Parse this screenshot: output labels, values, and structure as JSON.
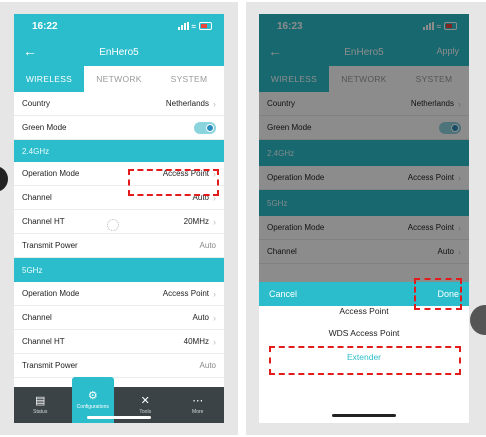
{
  "left": {
    "status": {
      "time": "16:22"
    },
    "navbar": {
      "title": "EnHero5"
    },
    "tabs": [
      "WIRELESS",
      "NETWORK",
      "SYSTEM"
    ],
    "rows_top": [
      {
        "label": "Country",
        "value": "Netherlands"
      },
      {
        "label": "Green Mode",
        "value": "",
        "toggle_on": true
      }
    ],
    "section_24": "2.4GHz",
    "rows_24": [
      {
        "label": "Operation Mode",
        "value": "Access Point"
      },
      {
        "label": "Channel",
        "value": "Auto"
      },
      {
        "label": "Channel HT",
        "value": "20MHz"
      },
      {
        "label": "Transmit Power",
        "value": "Auto"
      }
    ],
    "section_5": "5GHz",
    "rows_5": [
      {
        "label": "Operation Mode",
        "value": "Access Point"
      },
      {
        "label": "Channel",
        "value": "Auto"
      },
      {
        "label": "Channel HT",
        "value": "40MHz"
      },
      {
        "label": "Transmit Power",
        "value": "Auto"
      }
    ],
    "bottom_nav": [
      {
        "label": "Status",
        "icon": "chart-icon"
      },
      {
        "label": "Configurations",
        "icon": "gear-icon",
        "active": true
      },
      {
        "label": "Tools",
        "icon": "tools-icon"
      },
      {
        "label": "More",
        "icon": "more-icon"
      }
    ]
  },
  "right": {
    "status": {
      "time": "16:23"
    },
    "navbar": {
      "title": "EnHero5",
      "apply": "Apply"
    },
    "tabs": [
      "WIRELESS",
      "NETWORK",
      "SYSTEM"
    ],
    "rows_top": [
      {
        "label": "Country",
        "value": "Netherlands"
      },
      {
        "label": "Green Mode",
        "value": "",
        "toggle_on": true
      }
    ],
    "section_24": "2.4GHz",
    "rows_24": [
      {
        "label": "Operation Mode",
        "value": "Access Point"
      }
    ],
    "section_5": "5GHz",
    "rows_5": [
      {
        "label": "Operation Mode",
        "value": "Access Point"
      },
      {
        "label": "Channel",
        "value": "Auto"
      }
    ],
    "picker": {
      "cancel": "Cancel",
      "done": "Done",
      "options": [
        "Access Point",
        "WDS Access Point",
        "Extender"
      ],
      "selected_index": 2
    }
  },
  "colors": {
    "accent": "#2bbdcb",
    "highlight": "#e21b1b",
    "bottom_bar": "#3b4347"
  }
}
